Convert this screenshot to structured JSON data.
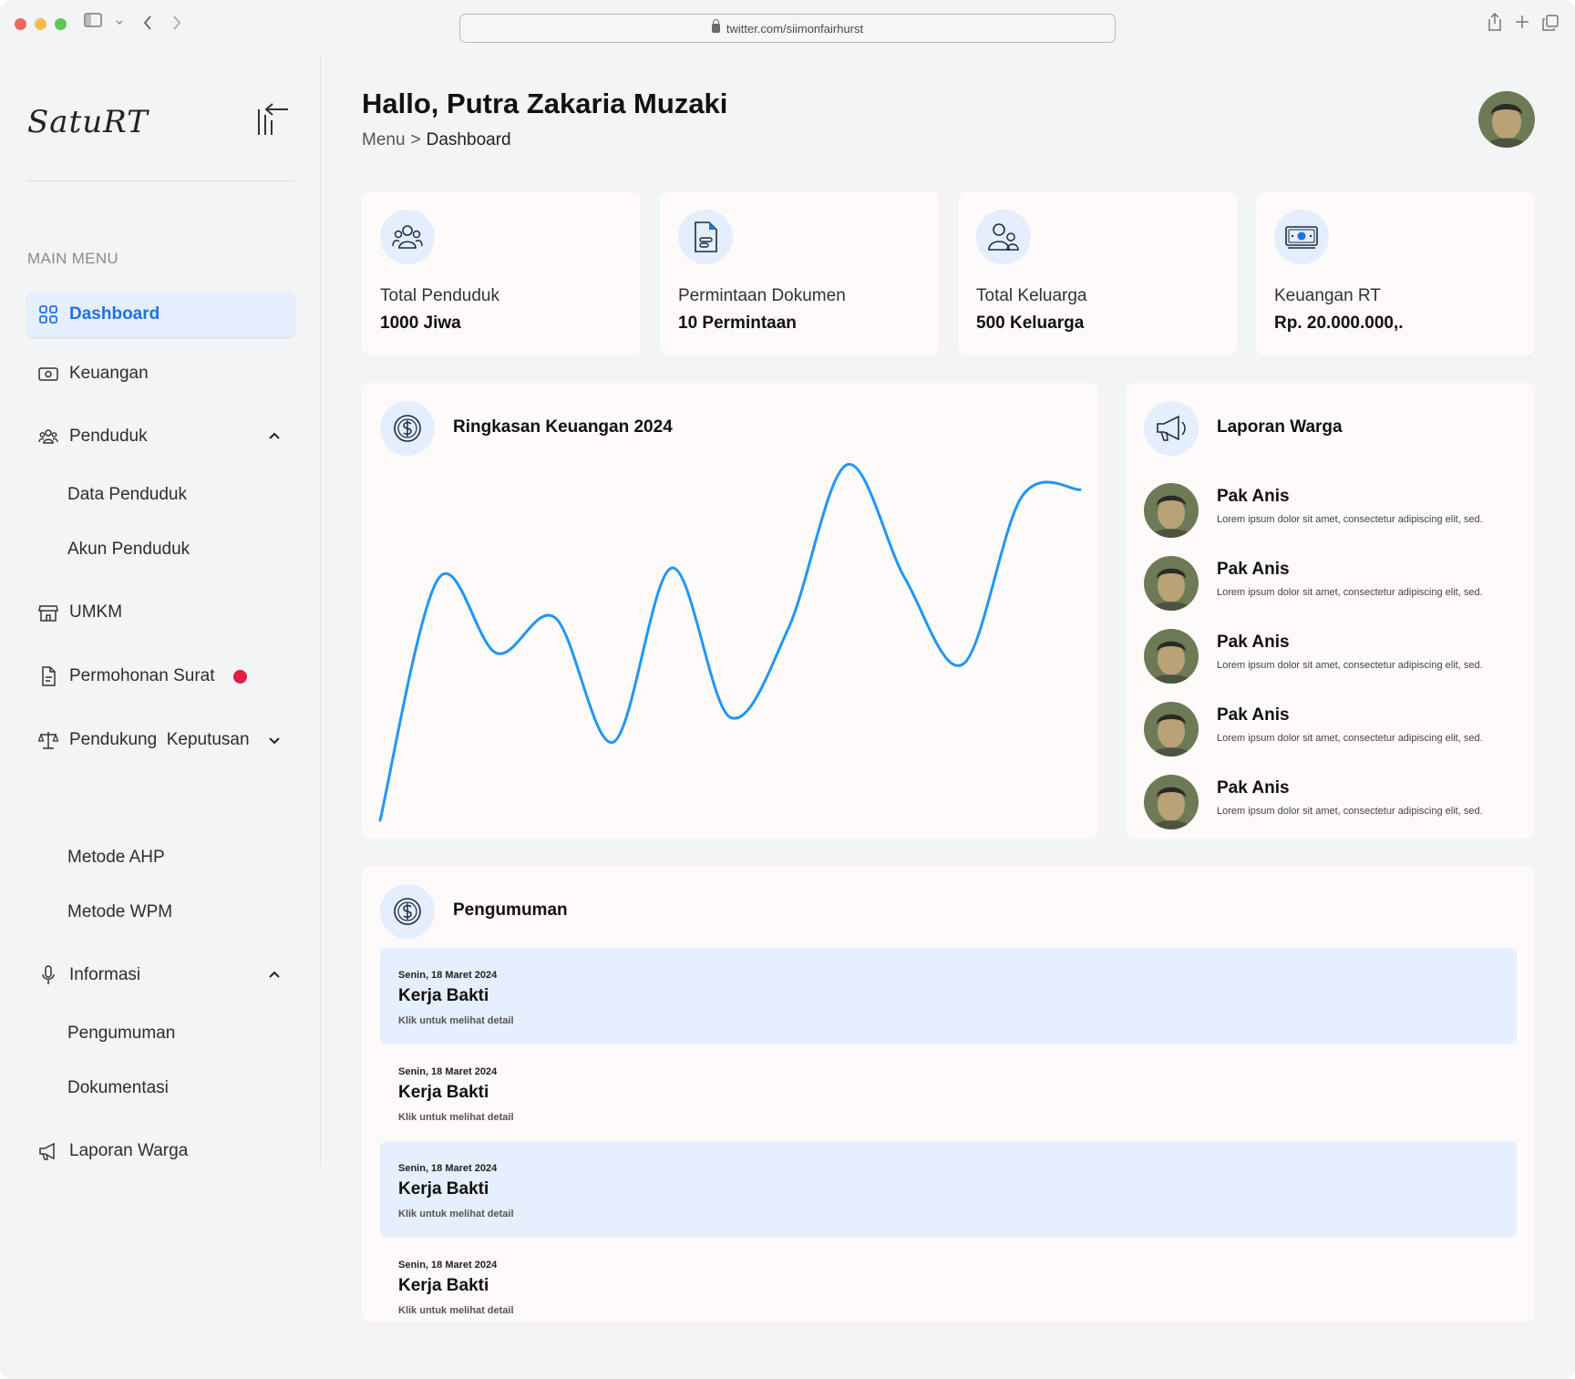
{
  "browser": {
    "url": "twitter.com/siimonfairhurst"
  },
  "sidebar": {
    "logo": "SatuRT",
    "section_label": "MAIN MENU",
    "items": {
      "dashboard": "Dashboard",
      "keuangan": "Keuangan",
      "penduduk": "Penduduk",
      "data_penduduk": "Data Penduduk",
      "akun_penduduk": "Akun Penduduk",
      "umkm": "UMKM",
      "permohonan_surat": "Permohonan Surat",
      "pendukung_keputusan": "Pendukung  Keputusan",
      "metode_ahp": "Metode AHP",
      "metode_wpm": "Metode WPM",
      "informasi": "Informasi",
      "pengumuman": "Pengumuman",
      "dokumentasi": "Dokumentasi",
      "laporan_warga": "Laporan Warga"
    },
    "colors": {
      "active_bg": "#e5efff",
      "active_text": "#1a73e8",
      "badge": "#e11d48"
    }
  },
  "header": {
    "greeting": "Hallo, Putra Zakaria Muzaki",
    "breadcrumb": {
      "root": "Menu",
      "separator": ">",
      "current": "Dashboard"
    }
  },
  "stats": [
    {
      "icon": "people-group-icon",
      "label": "Total Penduduk",
      "value": "1000 Jiwa"
    },
    {
      "icon": "document-icon",
      "label": "Permintaan Dokumen",
      "value": "10 Permintaan"
    },
    {
      "icon": "family-icon",
      "label": "Total Keluarga",
      "value": "500 Keluarga"
    },
    {
      "icon": "money-bill-icon",
      "label": "Keuangan RT",
      "value": "Rp. 20.000.000,."
    }
  ],
  "finance_chart": {
    "title": "Ringkasan Keuangan 2024",
    "icon": "dollar-circle-icon",
    "line_color": "#2196f3"
  },
  "chart_data": {
    "type": "line",
    "title": "Ringkasan Keuangan 2024",
    "xlabel": "",
    "ylabel": "",
    "grid": false,
    "axes_visible": false,
    "x": [
      0,
      1,
      2,
      3,
      4,
      5,
      6,
      7,
      8,
      9,
      10,
      11,
      12
    ],
    "series": [
      {
        "values": [
          0,
          68,
          47,
          57,
          22,
          71,
          29,
          54,
          100,
          68,
          44,
          91,
          93
        ]
      }
    ]
  },
  "reports": {
    "title": "Laporan Warga",
    "icon": "megaphone-icon",
    "items": [
      {
        "name": "Pak Anis",
        "text": "Lorem ipsum dolor sit amet, consectetur adipiscing elit, sed."
      },
      {
        "name": "Pak Anis",
        "text": "Lorem ipsum dolor sit amet, consectetur adipiscing elit, sed."
      },
      {
        "name": "Pak Anis",
        "text": "Lorem ipsum dolor sit amet, consectetur adipiscing elit, sed."
      },
      {
        "name": "Pak Anis",
        "text": "Lorem ipsum dolor sit amet, consectetur adipiscing elit, sed."
      },
      {
        "name": "Pak Anis",
        "text": "Lorem ipsum dolor sit amet, consectetur adipiscing elit, sed."
      }
    ]
  },
  "announcements": {
    "title": "Pengumuman",
    "icon": "dollar-circle-icon",
    "items": [
      {
        "date": "Senin, 18 Maret 2024",
        "title": "Kerja Bakti",
        "hint": "Klik untuk melihat detail"
      },
      {
        "date": "Senin, 18 Maret 2024",
        "title": "Kerja Bakti",
        "hint": "Klik untuk melihat detail"
      },
      {
        "date": "Senin, 18 Maret 2024",
        "title": "Kerja Bakti",
        "hint": "Klik untuk melihat detail"
      },
      {
        "date": "Senin, 18 Maret 2024",
        "title": "Kerja Bakti",
        "hint": "Klik untuk melihat detail"
      }
    ]
  }
}
